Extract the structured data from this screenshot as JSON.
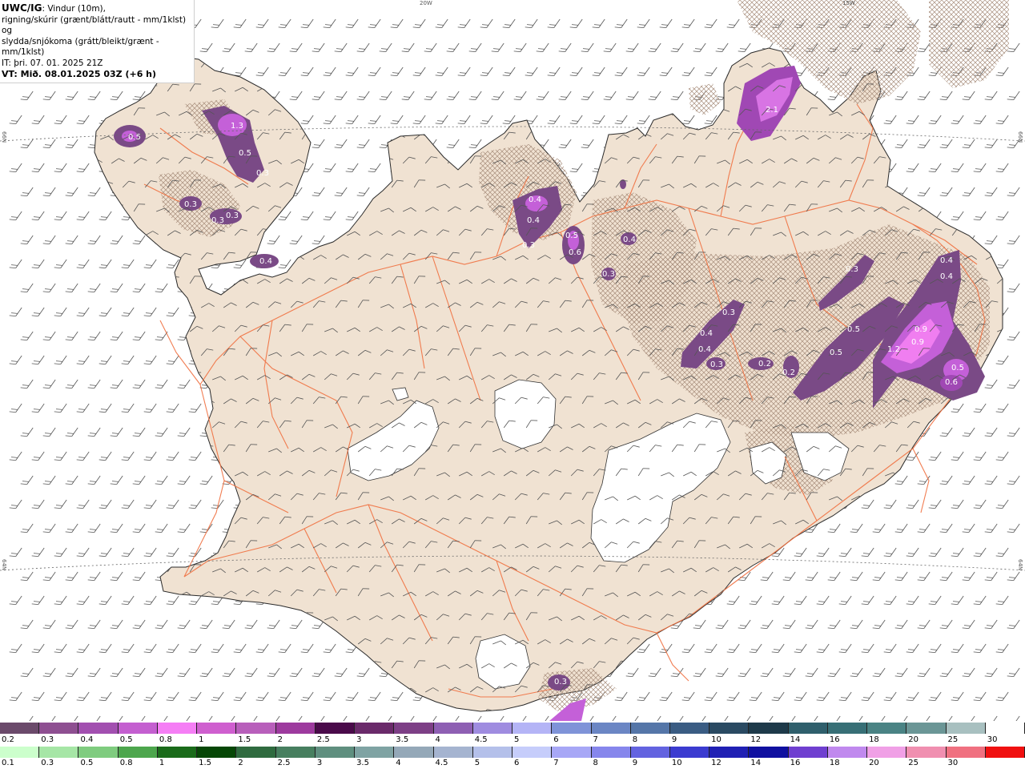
{
  "info": {
    "product": "UWC/IG",
    "line1_rest": ": Vindur (10m),",
    "line2": "rigning/skúrir (grænt/blátt/rautt - mm/1klst) og",
    "line3": "slydda/snjókoma (grátt/bleikt/grænt - mm/1klst)",
    "line4": "IT: þri. 07. 01. 2025 21Z",
    "line5": "VT: Mið. 08.01.2025 03Z (+6 h)"
  },
  "coords": {
    "top_20w": "20W",
    "top_15w": "15W",
    "left_66n": "66N",
    "left_64n": "64N",
    "right_66n": "66N",
    "right_64n": "64N"
  },
  "precip_labels": [
    {
      "id": "westfjords-a",
      "text": "0.5"
    },
    {
      "id": "westfjords-b",
      "text": "1.3"
    },
    {
      "id": "westfjords-c",
      "text": "0.5"
    },
    {
      "id": "westfjords-d",
      "text": "0.3"
    },
    {
      "id": "westfjords-e",
      "text": "0.3"
    },
    {
      "id": "westfjords-f",
      "text": "0.3"
    },
    {
      "id": "westfjords-g",
      "text": "0.3"
    },
    {
      "id": "westfjords-h",
      "text": "0.4"
    },
    {
      "id": "north-a",
      "text": "2.1"
    },
    {
      "id": "north-b",
      "text": "0.4"
    },
    {
      "id": "north-c",
      "text": "0.4"
    },
    {
      "id": "north-d",
      "text": "0.3"
    },
    {
      "id": "north-e",
      "text": "0.5"
    },
    {
      "id": "north-f",
      "text": "0.6"
    },
    {
      "id": "north-g",
      "text": "0.4"
    },
    {
      "id": "north-h",
      "text": "0.3"
    },
    {
      "id": "east-a",
      "text": "0.4"
    },
    {
      "id": "east-b",
      "text": "0.4"
    },
    {
      "id": "east-c",
      "text": "0.3"
    },
    {
      "id": "east-d",
      "text": "0.3"
    },
    {
      "id": "east-e",
      "text": "0.4"
    },
    {
      "id": "east-f",
      "text": "0.4"
    },
    {
      "id": "east-g",
      "text": "0.3"
    },
    {
      "id": "east-h",
      "text": "0.2"
    },
    {
      "id": "east-i",
      "text": "0.2"
    },
    {
      "id": "east-j",
      "text": "0.5"
    },
    {
      "id": "east-k",
      "text": "0.5"
    },
    {
      "id": "east-l",
      "text": "0.9"
    },
    {
      "id": "east-m",
      "text": "0.9"
    },
    {
      "id": "east-n",
      "text": "1.2"
    },
    {
      "id": "east-o",
      "text": "0.5"
    },
    {
      "id": "east-p",
      "text": "0.6"
    },
    {
      "id": "south-a",
      "text": "0.3"
    }
  ],
  "legend_snow": {
    "colors": [
      "#6b4a6b",
      "#8e4f91",
      "#a24fb0",
      "#c45fd0",
      "#f57ef5",
      "#cf5fcf",
      "#b85fbb",
      "#9d3a9e",
      "#4a0a4a",
      "#6a2a6a",
      "#7d3f86",
      "#8e5fb3",
      "#9f8ce0",
      "#b4b4f6",
      "#7f93d8",
      "#6b86c4",
      "#5576a8",
      "#3a5c83",
      "#2a4a62",
      "#1e3a4a",
      "#2f5f6c",
      "#376f76",
      "#4a8384",
      "#6b9696",
      "#a8c0c0",
      "#ffffff"
    ],
    "labels": [
      "0.2",
      "0.3",
      "0.4",
      "0.5",
      "0.8",
      "1",
      "1.5",
      "2",
      "2.5",
      "3",
      "3.5",
      "4",
      "4.5",
      "5",
      "6",
      "7",
      "8",
      "9",
      "10",
      "12",
      "14",
      "16",
      "18",
      "20",
      "25",
      "30"
    ]
  },
  "legend_rain": {
    "colors": [
      "#ccffcc",
      "#a6e6a6",
      "#7fcc7f",
      "#4da64d",
      "#1a6b1a",
      "#064706",
      "#2f6b3f",
      "#477f5f",
      "#5f8f7f",
      "#7fa3a3",
      "#94a8b8",
      "#a5b4d0",
      "#b4c0ea",
      "#c6cdfb",
      "#a7a7f6",
      "#8686ec",
      "#6363e0",
      "#3b3bd0",
      "#2020b4",
      "#1010a0",
      "#6f3fd0",
      "#c089ee",
      "#f0a0e6",
      "#f08fb0",
      "#f07080",
      "#f01010"
    ],
    "labels": [
      "0.1",
      "0.3",
      "0.5",
      "0.8",
      "1",
      "1.5",
      "2",
      "2.5",
      "3",
      "3.5",
      "4",
      "4.5",
      "5",
      "6",
      "7",
      "8",
      "9",
      "10",
      "12",
      "14",
      "16",
      "18",
      "20",
      "25",
      "30"
    ]
  },
  "colors": {
    "land": "#f0e2d2",
    "glacier": "#ffffff",
    "road": "#f07040",
    "wind_barb": "#555555"
  }
}
